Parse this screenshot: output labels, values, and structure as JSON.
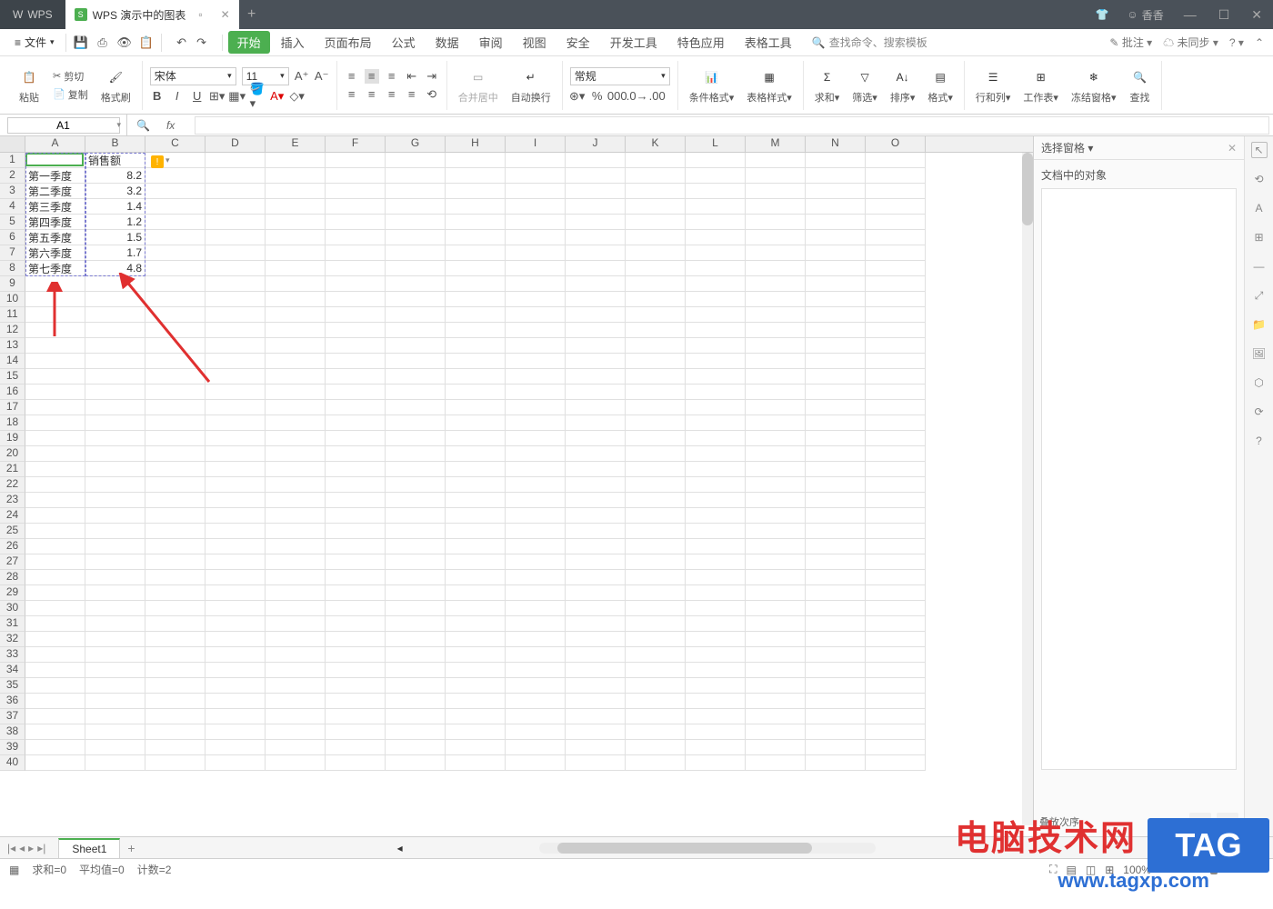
{
  "titlebar": {
    "app": "WPS",
    "doc": "WPS 演示中的图表",
    "user": "香香"
  },
  "menubar": {
    "file": "文件",
    "items": [
      "开始",
      "插入",
      "页面布局",
      "公式",
      "数据",
      "审阅",
      "视图",
      "安全",
      "开发工具",
      "特色应用",
      "表格工具"
    ],
    "search_placeholder": "查找命令、搜索模板",
    "annotate": "批注",
    "sync": "未同步"
  },
  "ribbon": {
    "paste": "粘贴",
    "cut": "剪切",
    "copy": "复制",
    "format_painter": "格式刷",
    "font_name": "宋体",
    "font_size": "11",
    "merge_center": "合并居中",
    "wrap": "自动换行",
    "number_format": "常规",
    "cond_format": "条件格式",
    "table_style": "表格样式",
    "sum": "求和",
    "filter": "筛选",
    "sort": "排序",
    "format": "格式",
    "rowcol": "行和列",
    "worksheet": "工作表",
    "freeze": "冻结窗格",
    "find": "查找"
  },
  "namebox": {
    "ref": "A1"
  },
  "panel": {
    "title": "选择窗格",
    "subtitle": "文档中的对象",
    "stack": "叠放次序"
  },
  "sheet": {
    "columns": [
      "A",
      "B",
      "C",
      "D",
      "E",
      "F",
      "G",
      "H",
      "I",
      "J",
      "K",
      "L",
      "M",
      "N",
      "O"
    ],
    "header_b": "销售额",
    "data": [
      {
        "label": "第一季度",
        "value": "8.2"
      },
      {
        "label": "第二季度",
        "value": "3.2"
      },
      {
        "label": "第三季度",
        "value": "1.4"
      },
      {
        "label": "第四季度",
        "value": "1.2"
      },
      {
        "label": "第五季度",
        "value": "1.5"
      },
      {
        "label": "第六季度",
        "value": "1.7"
      },
      {
        "label": "第七季度",
        "value": "4.8"
      }
    ],
    "tab": "Sheet1"
  },
  "status": {
    "sum": "求和=0",
    "avg": "平均值=0",
    "count": "计数=2",
    "zoom": "100%"
  },
  "watermark": {
    "site_cn": "电脑技术网",
    "tag": "TAG",
    "url": "www.tagxp.com"
  }
}
